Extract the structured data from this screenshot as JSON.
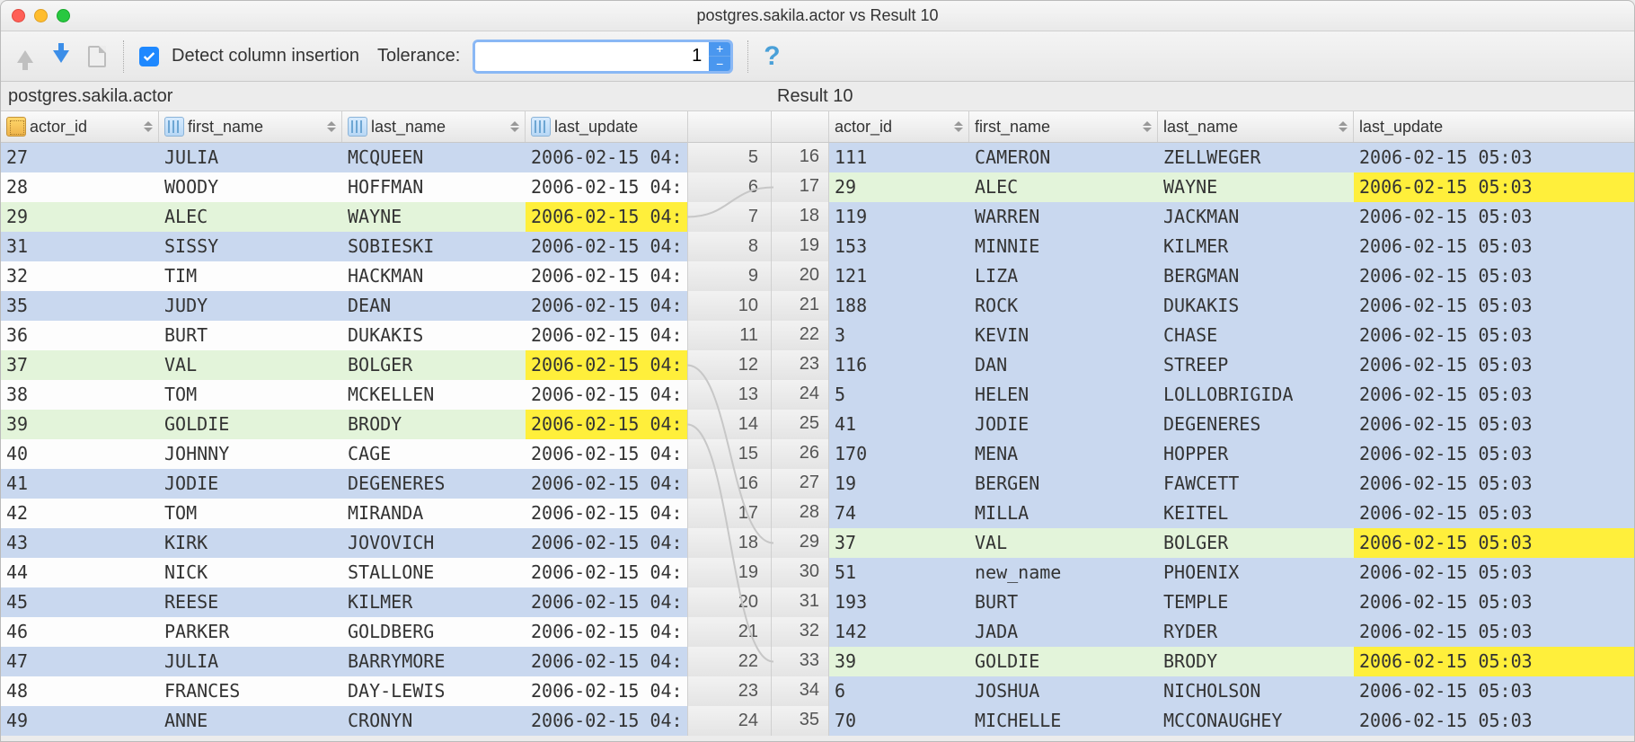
{
  "window": {
    "title": "postgres.sakila.actor vs Result 10"
  },
  "toolbar": {
    "detect_label": "Detect column insertion",
    "detect_checked": true,
    "tolerance_label": "Tolerance:",
    "tolerance_value": "1"
  },
  "left_pane": {
    "label": "postgres.sakila.actor",
    "columns": [
      "actor_id",
      "first_name",
      "last_name",
      "last_update"
    ],
    "rows": [
      {
        "n": "5",
        "kind": "blue",
        "actor_id": "27",
        "first_name": "JULIA",
        "last_name": "MCQUEEN",
        "last_update": "2006-02-15 04:",
        "hl": false
      },
      {
        "n": "6",
        "kind": "white",
        "actor_id": "28",
        "first_name": "WOODY",
        "last_name": "HOFFMAN",
        "last_update": "2006-02-15 04:",
        "hl": false
      },
      {
        "n": "7",
        "kind": "green",
        "actor_id": "29",
        "first_name": "ALEC",
        "last_name": "WAYNE",
        "last_update": "2006-02-15 04:",
        "hl": true
      },
      {
        "n": "8",
        "kind": "blue",
        "actor_id": "31",
        "first_name": "SISSY",
        "last_name": "SOBIESKI",
        "last_update": "2006-02-15 04:",
        "hl": false
      },
      {
        "n": "9",
        "kind": "white",
        "actor_id": "32",
        "first_name": "TIM",
        "last_name": "HACKMAN",
        "last_update": "2006-02-15 04:",
        "hl": false
      },
      {
        "n": "10",
        "kind": "blue",
        "actor_id": "35",
        "first_name": "JUDY",
        "last_name": "DEAN",
        "last_update": "2006-02-15 04:",
        "hl": false
      },
      {
        "n": "11",
        "kind": "white",
        "actor_id": "36",
        "first_name": "BURT",
        "last_name": "DUKAKIS",
        "last_update": "2006-02-15 04:",
        "hl": false
      },
      {
        "n": "12",
        "kind": "green",
        "actor_id": "37",
        "first_name": "VAL",
        "last_name": "BOLGER",
        "last_update": "2006-02-15 04:",
        "hl": true
      },
      {
        "n": "13",
        "kind": "white",
        "actor_id": "38",
        "first_name": "TOM",
        "last_name": "MCKELLEN",
        "last_update": "2006-02-15 04:",
        "hl": false
      },
      {
        "n": "14",
        "kind": "green",
        "actor_id": "39",
        "first_name": "GOLDIE",
        "last_name": "BRODY",
        "last_update": "2006-02-15 04:",
        "hl": true
      },
      {
        "n": "15",
        "kind": "white",
        "actor_id": "40",
        "first_name": "JOHNNY",
        "last_name": "CAGE",
        "last_update": "2006-02-15 04:",
        "hl": false
      },
      {
        "n": "16",
        "kind": "blue",
        "actor_id": "41",
        "first_name": "JODIE",
        "last_name": "DEGENERES",
        "last_update": "2006-02-15 04:",
        "hl": false
      },
      {
        "n": "17",
        "kind": "white",
        "actor_id": "42",
        "first_name": "TOM",
        "last_name": "MIRANDA",
        "last_update": "2006-02-15 04:",
        "hl": false
      },
      {
        "n": "18",
        "kind": "blue",
        "actor_id": "43",
        "first_name": "KIRK",
        "last_name": "JOVOVICH",
        "last_update": "2006-02-15 04:",
        "hl": false
      },
      {
        "n": "19",
        "kind": "white",
        "actor_id": "44",
        "first_name": "NICK",
        "last_name": "STALLONE",
        "last_update": "2006-02-15 04:",
        "hl": false
      },
      {
        "n": "20",
        "kind": "blue",
        "actor_id": "45",
        "first_name": "REESE",
        "last_name": "KILMER",
        "last_update": "2006-02-15 04:",
        "hl": false
      },
      {
        "n": "21",
        "kind": "white",
        "actor_id": "46",
        "first_name": "PARKER",
        "last_name": "GOLDBERG",
        "last_update": "2006-02-15 04:",
        "hl": false
      },
      {
        "n": "22",
        "kind": "blue",
        "actor_id": "47",
        "first_name": "JULIA",
        "last_name": "BARRYMORE",
        "last_update": "2006-02-15 04:",
        "hl": false
      },
      {
        "n": "23",
        "kind": "white",
        "actor_id": "48",
        "first_name": "FRANCES",
        "last_name": "DAY-LEWIS",
        "last_update": "2006-02-15 04:",
        "hl": false
      },
      {
        "n": "24",
        "kind": "blue",
        "actor_id": "49",
        "first_name": "ANNE",
        "last_name": "CRONYN",
        "last_update": "2006-02-15 04:",
        "hl": false
      }
    ]
  },
  "right_pane": {
    "label": "Result 10",
    "columns": [
      "",
      "actor_id",
      "first_name",
      "last_name",
      "last_update"
    ],
    "rows": [
      {
        "n": "16",
        "kind": "blue",
        "actor_id": "111",
        "first_name": "CAMERON",
        "last_name": "ZELLWEGER",
        "last_update": "2006-02-15 05:03",
        "hl": false
      },
      {
        "n": "17",
        "kind": "green",
        "actor_id": "29",
        "first_name": "ALEC",
        "last_name": "WAYNE",
        "last_update": "2006-02-15 05:03",
        "hl": true
      },
      {
        "n": "18",
        "kind": "blue",
        "actor_id": "119",
        "first_name": "WARREN",
        "last_name": "JACKMAN",
        "last_update": "2006-02-15 05:03",
        "hl": false
      },
      {
        "n": "19",
        "kind": "blue",
        "actor_id": "153",
        "first_name": "MINNIE",
        "last_name": "KILMER",
        "last_update": "2006-02-15 05:03",
        "hl": false
      },
      {
        "n": "20",
        "kind": "blue",
        "actor_id": "121",
        "first_name": "LIZA",
        "last_name": "BERGMAN",
        "last_update": "2006-02-15 05:03",
        "hl": false
      },
      {
        "n": "21",
        "kind": "blue",
        "actor_id": "188",
        "first_name": "ROCK",
        "last_name": "DUKAKIS",
        "last_update": "2006-02-15 05:03",
        "hl": false
      },
      {
        "n": "22",
        "kind": "blue",
        "actor_id": "3",
        "first_name": "KEVIN",
        "last_name": "CHASE",
        "last_update": "2006-02-15 05:03",
        "hl": false
      },
      {
        "n": "23",
        "kind": "blue",
        "actor_id": "116",
        "first_name": "DAN",
        "last_name": "STREEP",
        "last_update": "2006-02-15 05:03",
        "hl": false
      },
      {
        "n": "24",
        "kind": "blue",
        "actor_id": "5",
        "first_name": "HELEN",
        "last_name": "LOLLOBRIGIDA",
        "last_update": "2006-02-15 05:03",
        "hl": false
      },
      {
        "n": "25",
        "kind": "blue",
        "actor_id": "41",
        "first_name": "JODIE",
        "last_name": "DEGENERES",
        "last_update": "2006-02-15 05:03",
        "hl": false
      },
      {
        "n": "26",
        "kind": "blue",
        "actor_id": "170",
        "first_name": "MENA",
        "last_name": "HOPPER",
        "last_update": "2006-02-15 05:03",
        "hl": false
      },
      {
        "n": "27",
        "kind": "blue",
        "actor_id": "19",
        "first_name": "BERGEN",
        "last_name": "FAWCETT",
        "last_update": "2006-02-15 05:03",
        "hl": false
      },
      {
        "n": "28",
        "kind": "blue",
        "actor_id": "74",
        "first_name": "MILLA",
        "last_name": "KEITEL",
        "last_update": "2006-02-15 05:03",
        "hl": false
      },
      {
        "n": "29",
        "kind": "green",
        "actor_id": "37",
        "first_name": "VAL",
        "last_name": "BOLGER",
        "last_update": "2006-02-15 05:03",
        "hl": true
      },
      {
        "n": "30",
        "kind": "blue",
        "actor_id": "51",
        "first_name": "new_name",
        "last_name": "PHOENIX",
        "last_update": "2006-02-15 05:03",
        "hl": false
      },
      {
        "n": "31",
        "kind": "blue",
        "actor_id": "193",
        "first_name": "BURT",
        "last_name": "TEMPLE",
        "last_update": "2006-02-15 05:03",
        "hl": false
      },
      {
        "n": "32",
        "kind": "blue",
        "actor_id": "142",
        "first_name": "JADA",
        "last_name": "RYDER",
        "last_update": "2006-02-15 05:03",
        "hl": false
      },
      {
        "n": "33",
        "kind": "green",
        "actor_id": "39",
        "first_name": "GOLDIE",
        "last_name": "BRODY",
        "last_update": "2006-02-15 05:03",
        "hl": true
      },
      {
        "n": "34",
        "kind": "blue",
        "actor_id": "6",
        "first_name": "JOSHUA",
        "last_name": "NICHOLSON",
        "last_update": "2006-02-15 05:03",
        "hl": false
      },
      {
        "n": "35",
        "kind": "blue",
        "actor_id": "70",
        "first_name": "MICHELLE",
        "last_name": "MCCONAUGHEY",
        "last_update": "2006-02-15 05:03",
        "hl": false
      }
    ]
  }
}
